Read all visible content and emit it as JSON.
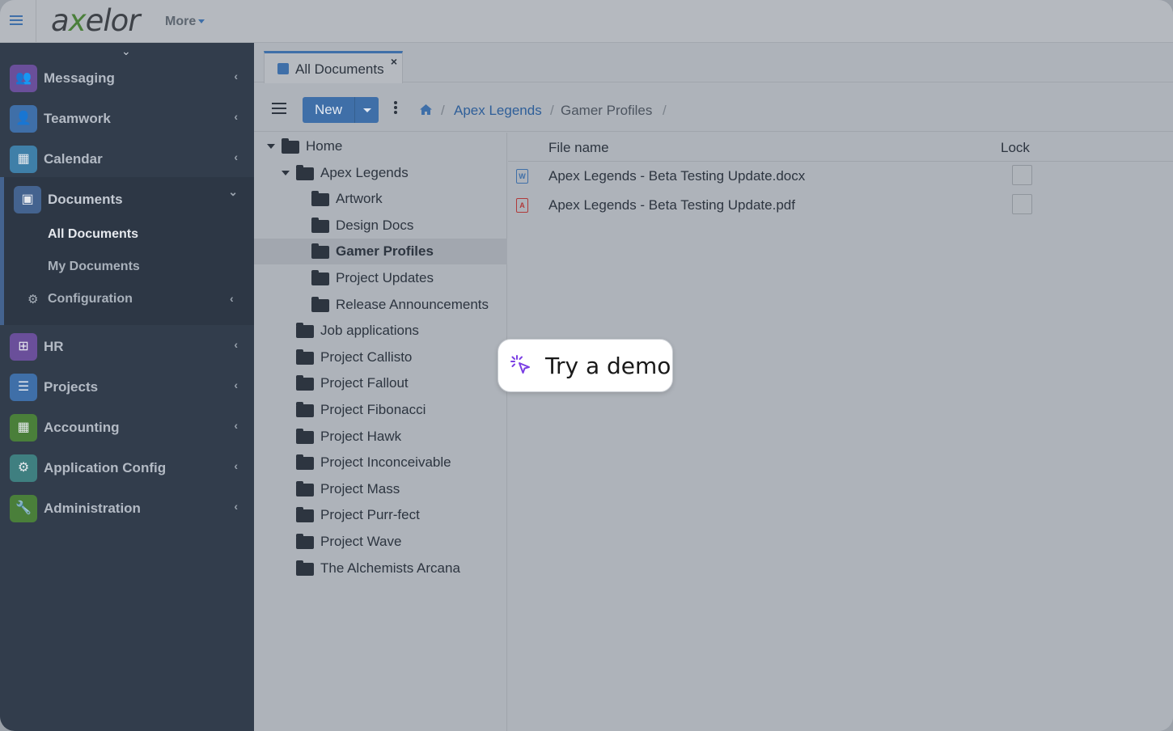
{
  "topbar": {
    "logo_text_a": "a",
    "logo_text_x": "x",
    "logo_text_rest": "elor",
    "more_label": "More"
  },
  "sidebar": {
    "items": [
      {
        "label": "Messaging",
        "icon": "users-icon",
        "color": "#6a4f9a"
      },
      {
        "label": "Teamwork",
        "icon": "user-icon",
        "color": "#3f6fa8"
      },
      {
        "label": "Calendar",
        "icon": "calendar-icon",
        "color": "#3f7fa8"
      },
      {
        "label": "Documents",
        "icon": "archive-icon",
        "color": "#44638f"
      },
      {
        "label": "HR",
        "icon": "sitemap-icon",
        "color": "#6a4f9a"
      },
      {
        "label": "Projects",
        "icon": "list-icon",
        "color": "#3f6fa8"
      },
      {
        "label": "Accounting",
        "icon": "calculator-icon",
        "color": "#4a7f3a"
      },
      {
        "label": "Application Config",
        "icon": "gear-icon",
        "color": "#3f7f80"
      },
      {
        "label": "Administration",
        "icon": "wrench-icon",
        "color": "#4a7f3a"
      }
    ],
    "documents_sub": {
      "all_documents": "All Documents",
      "my_documents": "My Documents",
      "configuration": "Configuration"
    }
  },
  "tab": {
    "label": "All Documents",
    "close": "×"
  },
  "toolbar": {
    "new_label": "New",
    "breadcrumb": [
      "Apex Legends",
      "Gamer Profiles"
    ],
    "sep": "/"
  },
  "tree": {
    "nodes": [
      {
        "label": "Home",
        "level": 0,
        "expanded": true
      },
      {
        "label": "Apex Legends",
        "level": 1,
        "expanded": true
      },
      {
        "label": "Artwork",
        "level": 2
      },
      {
        "label": "Design Docs",
        "level": 2
      },
      {
        "label": "Gamer Profiles",
        "level": 2,
        "selected": true
      },
      {
        "label": "Project Updates",
        "level": 2
      },
      {
        "label": "Release Announcements",
        "level": 2
      },
      {
        "label": "Job applications",
        "level": 1
      },
      {
        "label": "Project Callisto",
        "level": 1
      },
      {
        "label": "Project Fallout",
        "level": 1
      },
      {
        "label": "Project Fibonacci",
        "level": 1
      },
      {
        "label": "Project Hawk",
        "level": 1
      },
      {
        "label": "Project Inconceivable",
        "level": 1
      },
      {
        "label": "Project Mass",
        "level": 1
      },
      {
        "label": "Project Purr-fect",
        "level": 1
      },
      {
        "label": "Project Wave",
        "level": 1
      },
      {
        "label": "The Alchemists Arcana",
        "level": 1
      }
    ]
  },
  "files": {
    "columns": [
      "File name",
      "Lock"
    ],
    "rows": [
      {
        "name": "Apex Legends - Beta Testing Update.docx",
        "type": "word-file-icon",
        "color": "#3f6fa8",
        "glyph": "W",
        "locked": false
      },
      {
        "name": "Apex Legends - Beta Testing Update.pdf",
        "type": "pdf-file-icon",
        "color": "#b03a3a",
        "glyph": "A",
        "locked": false
      }
    ]
  },
  "demo": {
    "label": "Try a demo",
    "accent": "#7b3fe4"
  }
}
